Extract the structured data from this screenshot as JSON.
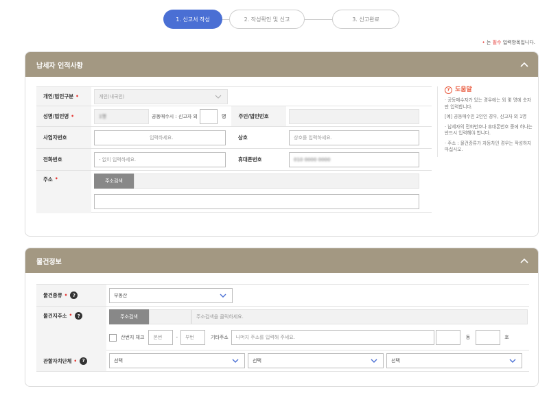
{
  "steps": {
    "step1": "1. 신고서 작성",
    "step2": "2. 작성확인 및 신고",
    "step3": "3. 신고완료"
  },
  "required_note": {
    "dot": "•",
    "prefix": "는 ",
    "emph": "필수",
    "suffix": " 입력항목입니다."
  },
  "taxpayer": {
    "title": "납세자 인적사항",
    "type_label": "개인/법인구분",
    "type_value": "개인(내국인)",
    "name_label": "성명/법인명",
    "name_value": "1명",
    "joint_text": "공동매수시 : 신고자 외",
    "joint_unit": "명",
    "rrn_label": "주민/법인번호",
    "biz_label": "사업자번호",
    "biz_placeholder": "입력하세요.",
    "trade_label": "상호",
    "trade_placeholder": "상호를 입력하세요.",
    "phone_label": "전화번호",
    "phone_placeholder": "- 없이 입력하세요.",
    "mobile_label": "휴대폰번호",
    "mobile_value": "010 0000 0000",
    "address_label": "주소",
    "address_button": "주소검색"
  },
  "help": {
    "title": "도움말",
    "items": [
      "· 공동매수자가 있는 경우에는 외 몇 명에 숫자만 입력합니다.",
      "[예] 공동매수인 2인인 경우, 신고자 외 1명",
      "· 납세자의 전화번호나 휴대폰번호 중에 하나는 반드시 입력해야 합니다.",
      "· 주소 : 물건종류가 자동차인 경우는 작성하지 마십시오."
    ]
  },
  "property": {
    "title": "물건정보",
    "kind_label": "물건종류",
    "kind_value": "부동산",
    "addr_label": "물건지주소",
    "addr_button": "주소검색",
    "addr_placeholder": "주소검색을 클릭하세요.",
    "mountain_check": "산번지 체크",
    "main_no": "본번",
    "dash": "-",
    "sub_no": "부번",
    "etc_label": "기타주소",
    "etc_placeholder": "나머지 주소를 입력해 주세요.",
    "dong": "동",
    "ho": "호",
    "gov_label": "관할자치단체",
    "select1": "선택",
    "select2": "선택",
    "select3": "선택"
  }
}
